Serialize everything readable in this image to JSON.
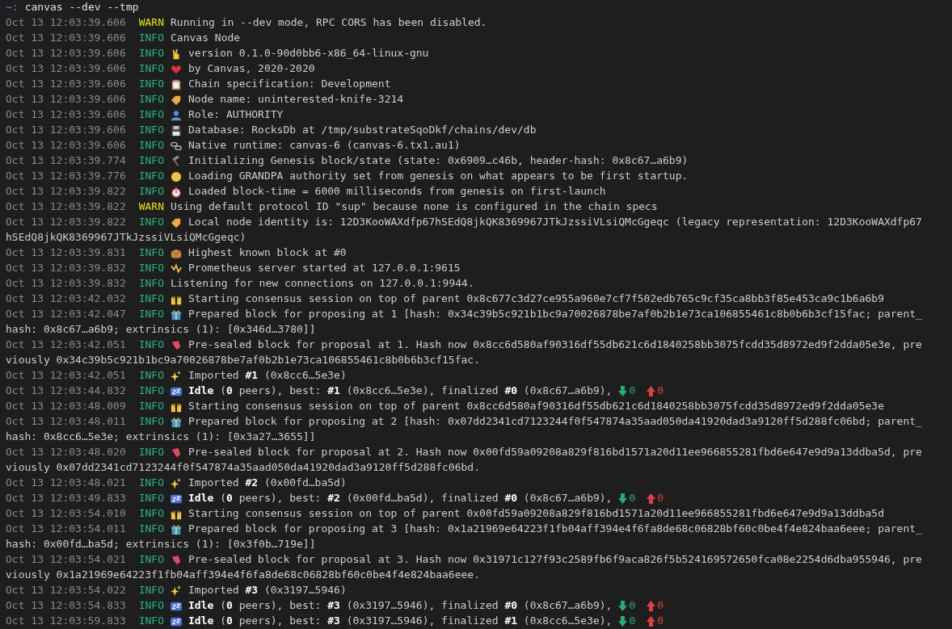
{
  "prompt": {
    "symbol": "~:",
    "command": "canvas --dev --tmp"
  },
  "lines": [
    {
      "time": "Oct 13 12:03:39.606",
      "level": "WARN",
      "message": "Running in --dev mode, RPC CORS has been disabled."
    },
    {
      "time": "Oct 13 12:03:39.606",
      "level": "INFO",
      "message": "Canvas Node"
    },
    {
      "time": "Oct 13 12:03:39.606",
      "level": "INFO",
      "kind": "hand",
      "message": "version 0.1.0-90d0bb6-x86_64-linux-gnu"
    },
    {
      "time": "Oct 13 12:03:39.606",
      "level": "INFO",
      "kind": "heart",
      "message": "by Canvas, 2020-2020"
    },
    {
      "time": "Oct 13 12:03:39.606",
      "level": "INFO",
      "kind": "clipboard",
      "message": "Chain specification: Development"
    },
    {
      "time": "Oct 13 12:03:39.606",
      "level": "INFO",
      "kind": "tag",
      "message": "Node name: uninterested-knife-3214"
    },
    {
      "time": "Oct 13 12:03:39.606",
      "level": "INFO",
      "kind": "person",
      "message": "Role: AUTHORITY"
    },
    {
      "time": "Oct 13 12:03:39.606",
      "level": "INFO",
      "kind": "floppy",
      "message": "Database: RocksDb at /tmp/substrateSqoDkf/chains/dev/db"
    },
    {
      "time": "Oct 13 12:03:39.606",
      "level": "INFO",
      "kind": "chain",
      "message": "Native runtime: canvas-6 (canvas-6.tx1.au1)"
    },
    {
      "time": "Oct 13 12:03:39.774",
      "level": "INFO",
      "kind": "hammer",
      "message": "Initializing Genesis block/state (state: 0x6909…c46b, header-hash: 0x8c67…a6b9)"
    },
    {
      "time": "Oct 13 12:03:39.776",
      "level": "INFO",
      "kind": "head",
      "message": "Loading GRANDPA authority set from genesis on what appears to be first startup."
    },
    {
      "time": "Oct 13 12:03:39.822",
      "level": "INFO",
      "kind": "stopwatch",
      "message": "Loaded block-time = 6000 milliseconds from genesis on first-launch"
    },
    {
      "time": "Oct 13 12:03:39.822",
      "level": "WARN",
      "message": "Using default protocol ID \"sup\" because none is configured in the chain specs"
    },
    {
      "time": "Oct 13 12:03:39.822",
      "level": "INFO",
      "kind": "tag",
      "message": "Local node identity is: 12D3KooWAXdfp67hSEdQ8jkQK8369967JTkJzssiVLsiQMcGgeqc (legacy representation: 12D3KooWAXdfp67",
      "wrap": "hSEdQ8jkQK8369967JTkJzssiVLsiQMcGgeqc)"
    },
    {
      "time": "Oct 13 12:03:39.831",
      "level": "INFO",
      "kind": "box",
      "message": "Highest known block at #0"
    },
    {
      "time": "Oct 13 12:03:39.832",
      "level": "INFO",
      "kind": "zigzag",
      "message": "Prometheus server started at 127.0.0.1:9615"
    },
    {
      "time": "Oct 13 12:03:39.832",
      "level": "INFO",
      "message": "Listening for new connections on 127.0.0.1:9944."
    },
    {
      "time": "Oct 13 12:03:42.032",
      "level": "INFO",
      "kind": "hands",
      "message": "Starting consensus session on top of parent 0x8c677c3d27ce955a960e7cf7f502edb765c9cf35ca8bb3f85e453ca9c1b6a6b9"
    },
    {
      "time": "Oct 13 12:03:42.047",
      "level": "INFO",
      "kind": "gift",
      "message": "Prepared block for proposing at 1 [hash: 0x34c39b5c921b1bc9a70026878be7af0b2b1e73ca106855461c8b0b6b3cf15fac; parent_",
      "wrap": "hash: 0x8c67…a6b9; extrinsics (1): [0x346d…3780]]"
    },
    {
      "time": "Oct 13 12:03:42.051",
      "level": "INFO",
      "kind": "bookmark",
      "message": "Pre-sealed block for proposal at 1. Hash now 0x8cc6d580af90316df55db621c6d1840258bb3075fcdd35d8972ed9f2dda05e3e, pre",
      "wrap": "viously 0x34c39b5c921b1bc9a70026878be7af0b2b1e73ca106855461c8b0b6b3cf15fac."
    },
    {
      "time": "Oct 13 12:03:42.051",
      "level": "INFO",
      "kind": "sparkles",
      "message": "Imported **#1** (0x8cc6…5e3e)"
    },
    {
      "time": "Oct 13 12:03:44.832",
      "level": "INFO",
      "kind": "sleep",
      "message": "**Idle** (**0** peers), best: **#1** (0x8cc6…5e3e), finalized **#0** (0x8c67…a6b9),",
      "traffic": {
        "down": "0",
        "up": "0"
      }
    },
    {
      "time": "Oct 13 12:03:48.009",
      "level": "INFO",
      "kind": "hands",
      "message": "Starting consensus session on top of parent 0x8cc6d580af90316df55db621c6d1840258bb3075fcdd35d8972ed9f2dda05e3e"
    },
    {
      "time": "Oct 13 12:03:48.011",
      "level": "INFO",
      "kind": "gift",
      "message": "Prepared block for proposing at 2 [hash: 0x07dd2341cd7123244f0f547874a35aad050da41920dad3a9120ff5d288fc06bd; parent_",
      "wrap": "hash: 0x8cc6…5e3e; extrinsics (1): [0x3a27…3655]]"
    },
    {
      "time": "Oct 13 12:03:48.020",
      "level": "INFO",
      "kind": "bookmark",
      "message": "Pre-sealed block for proposal at 2. Hash now 0x00fd59a09208a829f816bd1571a20d11ee966855281fbd6e647e9d9a13ddba5d, pre",
      "wrap": "viously 0x07dd2341cd7123244f0f547874a35aad050da41920dad3a9120ff5d288fc06bd."
    },
    {
      "time": "Oct 13 12:03:48.021",
      "level": "INFO",
      "kind": "sparkles",
      "message": "Imported **#2** (0x00fd…ba5d)"
    },
    {
      "time": "Oct 13 12:03:49.833",
      "level": "INFO",
      "kind": "sleep",
      "message": "**Idle** (**0** peers), best: **#2** (0x00fd…ba5d), finalized **#0** (0x8c67…a6b9),",
      "traffic": {
        "down": "0",
        "up": "0"
      }
    },
    {
      "time": "Oct 13 12:03:54.010",
      "level": "INFO",
      "kind": "hands",
      "message": "Starting consensus session on top of parent 0x00fd59a09208a829f816bd1571a20d11ee966855281fbd6e647e9d9a13ddba5d"
    },
    {
      "time": "Oct 13 12:03:54.011",
      "level": "INFO",
      "kind": "gift",
      "message": "Prepared block for proposing at 3 [hash: 0x1a21969e64223f1fb04aff394e4f6fa8de68c06828bf60c0be4f4e824baa6eee; parent_",
      "wrap": "hash: 0x00fd…ba5d; extrinsics (1): [0x3f0b…719e]]"
    },
    {
      "time": "Oct 13 12:03:54.021",
      "level": "INFO",
      "kind": "bookmark",
      "message": "Pre-sealed block for proposal at 3. Hash now 0x31971c127f93c2589fb6f9aca826f5b524169572650fca08e2254d6dba955946, pre",
      "wrap": "viously 0x1a21969e64223f1fb04aff394e4f6fa8de68c06828bf60c0be4f4e824baa6eee."
    },
    {
      "time": "Oct 13 12:03:54.022",
      "level": "INFO",
      "kind": "sparkles",
      "message": "Imported **#3** (0x3197…5946)"
    },
    {
      "time": "Oct 13 12:03:54.833",
      "level": "INFO",
      "kind": "sleep",
      "message": "**Idle** (**0** peers), best: **#3** (0x3197…5946), finalized **#0** (0x8c67…a6b9),",
      "traffic": {
        "down": "0",
        "up": "0"
      }
    },
    {
      "time": "Oct 13 12:03:59.833",
      "level": "INFO",
      "kind": "sleep",
      "message": "**Idle** (**0** peers), best: **#3** (0x3197…5946), finalized **#1** (0x8cc6…5e3e),",
      "traffic": {
        "down": "0",
        "up": "0"
      }
    }
  ]
}
